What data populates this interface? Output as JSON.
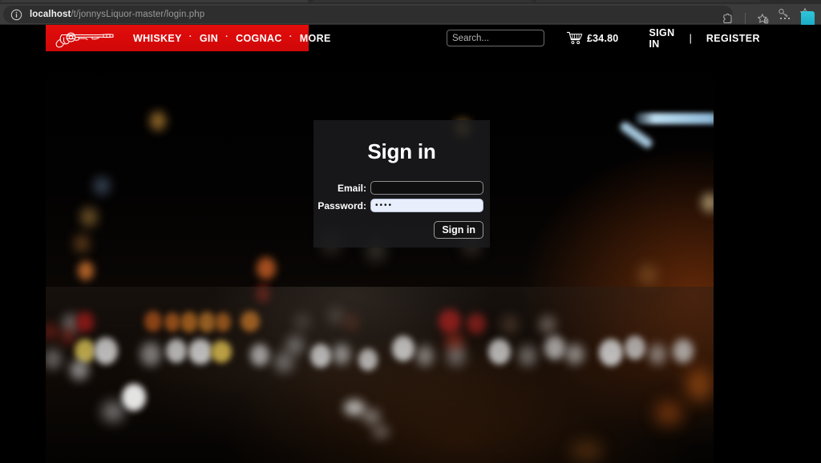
{
  "browser": {
    "url_host": "localhost",
    "url_path": "/t/jonnysLiquor-master/login.php",
    "info_icon": "info-circle-icon",
    "key_icon": "key-icon",
    "star_icon": "favorite-star-icon",
    "extensions_icon": "extensions-puzzle-icon",
    "collections_icon": "collections-icon",
    "more_icon": "more-options-ellipsis-icon",
    "profile_icon": "profile-avatar-icon"
  },
  "site": {
    "logo_icon": "revolver-pistol-logo-icon",
    "nav_items": [
      {
        "label": "WHISKEY"
      },
      {
        "label": "GIN"
      },
      {
        "label": "COGNAC"
      },
      {
        "label": "MORE"
      }
    ],
    "nav_separator": "·",
    "search": {
      "placeholder": "Search...",
      "value": ""
    },
    "cart": {
      "icon": "shopping-cart-icon",
      "total": "£34.80"
    },
    "auth": {
      "sign_in": "SIGN IN",
      "separator": "|",
      "register": "REGISTER"
    },
    "colors": {
      "nav_red": "#dd0a0a",
      "nav_text": "#ffffff",
      "page_background": "#000000"
    }
  },
  "login": {
    "title": "Sign in",
    "email": {
      "label": "Email:",
      "value": "",
      "placeholder": ""
    },
    "password": {
      "label": "Password:",
      "value": "••••",
      "placeholder": ""
    },
    "submit_label": "Sign in"
  }
}
